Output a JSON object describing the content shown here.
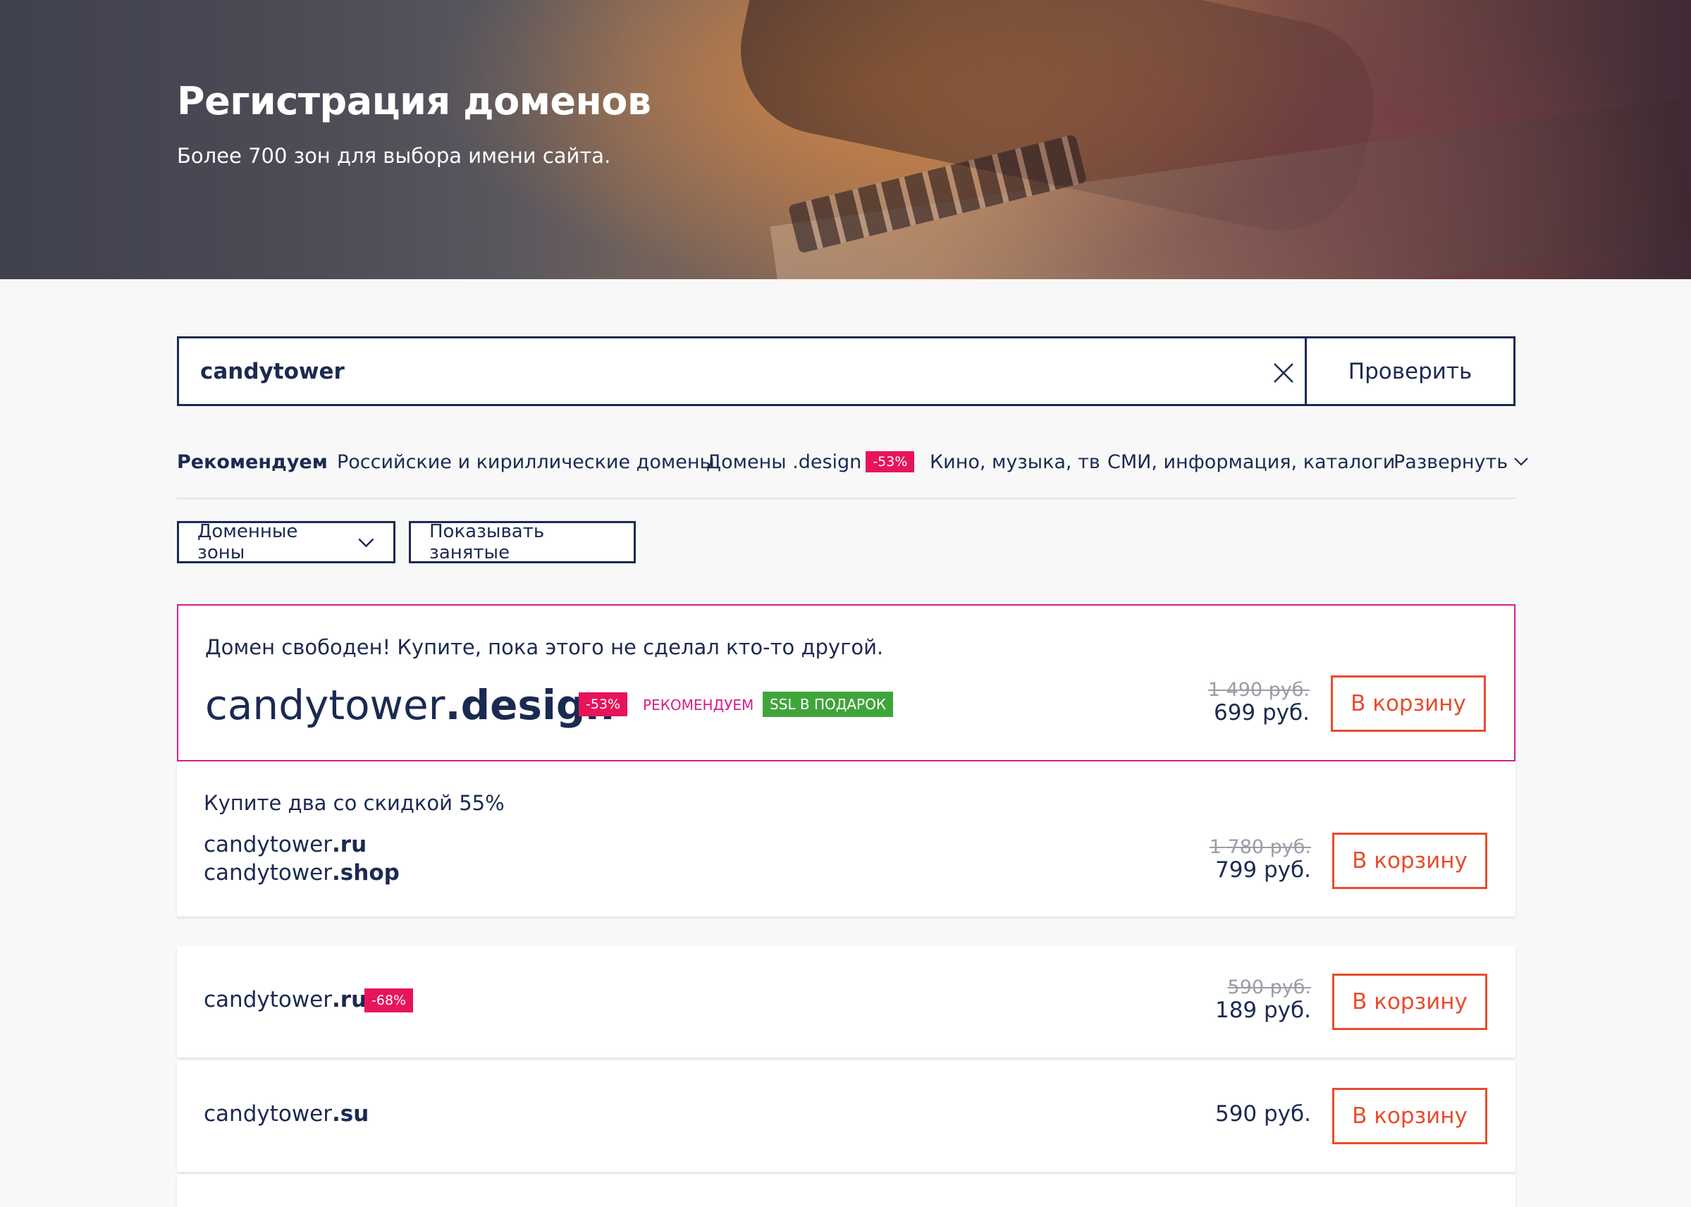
{
  "hero": {
    "title": "Регистрация доменов",
    "subtitle": "Более 700 зон для выбора имени сайта."
  },
  "search": {
    "value": "candytower",
    "button_label": "Проверить"
  },
  "tabs": [
    {
      "label": "Рекомендуем",
      "active": true
    },
    {
      "label": "Российские и кириллические домены"
    },
    {
      "label": "Домены .design",
      "badge": "-53%"
    },
    {
      "label": "Кино, музыка, тв"
    },
    {
      "label": "СМИ, информация, каталоги"
    },
    {
      "label": "Развернуть"
    }
  ],
  "filters": {
    "zones_label": "Доменные зоны",
    "show_taken_label": "Показывать занятые"
  },
  "featured": {
    "note": "Домен свободен! Купите, пока этого не сделал кто-то другой.",
    "name": "candytower",
    "zone": ".design",
    "discount": "-53%",
    "recommend_tag": "РЕКОМЕНДУЕМ",
    "ssl_tag": "SSL В ПОДАРОК",
    "old_price": "1 490 руб.",
    "price": "699 руб.",
    "cart_label": "В корзину"
  },
  "bundle": {
    "note": "Купите два со скидкой 55%",
    "domains": [
      {
        "name": "candytower",
        "zone": ".ru"
      },
      {
        "name": "candytower",
        "zone": ".shop"
      }
    ],
    "old_price": "1 780 руб.",
    "price": "799 руб.",
    "cart_label": "В корзину"
  },
  "results": [
    {
      "name": "candytower",
      "zone": ".ru",
      "discount": "-68%",
      "old_price": "590 руб.",
      "price": "189 руб.",
      "cart_label": "В корзину"
    },
    {
      "name": "candytower",
      "zone": ".su",
      "price": "590 руб.",
      "cart_label": "В корзину"
    }
  ],
  "colors": {
    "navy": "#1b2a52",
    "discount": "#e8145a",
    "recommend": "#d4208a",
    "ssl": "#3fa53a",
    "cart": "#e84c2c"
  }
}
